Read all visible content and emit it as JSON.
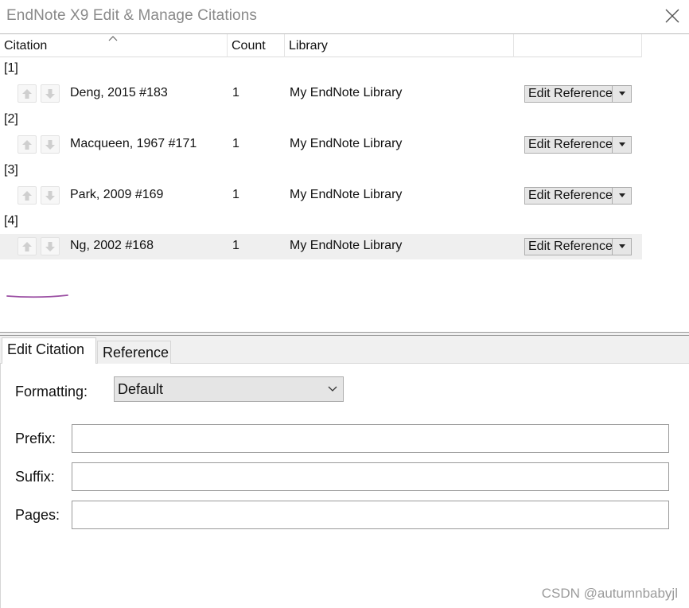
{
  "window": {
    "title": "EndNote X9 Edit & Manage Citations"
  },
  "columns": {
    "citation": "Citation",
    "count": "Count",
    "library": "Library"
  },
  "citations": [
    {
      "group": "[1]",
      "text": "Deng, 2015 #183",
      "count": "1",
      "library": "My EndNote Library",
      "action": "Edit Reference"
    },
    {
      "group": "[2]",
      "text": "Macqueen, 1967 #171",
      "count": "1",
      "library": "My EndNote Library",
      "action": "Edit Reference"
    },
    {
      "group": "[3]",
      "text": "Park, 2009 #169",
      "count": "1",
      "library": "My EndNote Library",
      "action": "Edit Reference"
    },
    {
      "group": "[4]",
      "text": "Ng, 2002 #168",
      "count": "1",
      "library": "My EndNote Library",
      "action": "Edit Reference"
    }
  ],
  "tabs": {
    "edit_citation": "Edit Citation",
    "reference": "Reference"
  },
  "form": {
    "formatting_label": "Formatting:",
    "formatting_value": "Default",
    "prefix_label": "Prefix:",
    "suffix_label": "Suffix:",
    "pages_label": "Pages:",
    "prefix_value": "",
    "suffix_value": "",
    "pages_value": ""
  },
  "watermark": "CSDN @autumnbabyjl",
  "colors": {
    "selected_row": "#efefef",
    "ink_underline": "#9b4fa3"
  }
}
